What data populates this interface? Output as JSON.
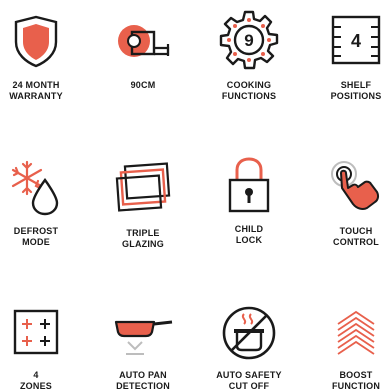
{
  "accent": "#e8604c",
  "ink": "#1a1a1a",
  "features": [
    {
      "line1": "24 MONTH",
      "line2": "WARRANTY",
      "icon": "shield-icon"
    },
    {
      "line1": "90CM",
      "line2": "",
      "icon": "tape-measure-icon"
    },
    {
      "line1": "COOKING",
      "line2": "FUNCTIONS",
      "icon": "gear-icon",
      "badge": "9"
    },
    {
      "line1": "SHELF",
      "line2": "POSITIONS",
      "icon": "shelf-icon",
      "badge": "4"
    },
    {
      "line1": "DEFROST",
      "line2": "MODE",
      "icon": "snowflake-drop-icon"
    },
    {
      "line1": "TRIPLE",
      "line2": "GLAZING",
      "icon": "glass-panes-icon"
    },
    {
      "line1": "CHILD",
      "line2": "LOCK",
      "icon": "padlock-icon"
    },
    {
      "line1": "TOUCH",
      "line2": "CONTROL",
      "icon": "touch-hand-icon"
    },
    {
      "line1": "4",
      "line2": "ZONES",
      "icon": "cooktop-zones-icon"
    },
    {
      "line1": "AUTO PAN",
      "line2": "DETECTION",
      "icon": "pan-icon"
    },
    {
      "line1": "AUTO SAFETY",
      "line2": "CUT OFF",
      "icon": "safety-cutoff-icon"
    },
    {
      "line1": "BOOST",
      "line2": "FUNCTION",
      "icon": "boost-chevrons-icon"
    }
  ]
}
